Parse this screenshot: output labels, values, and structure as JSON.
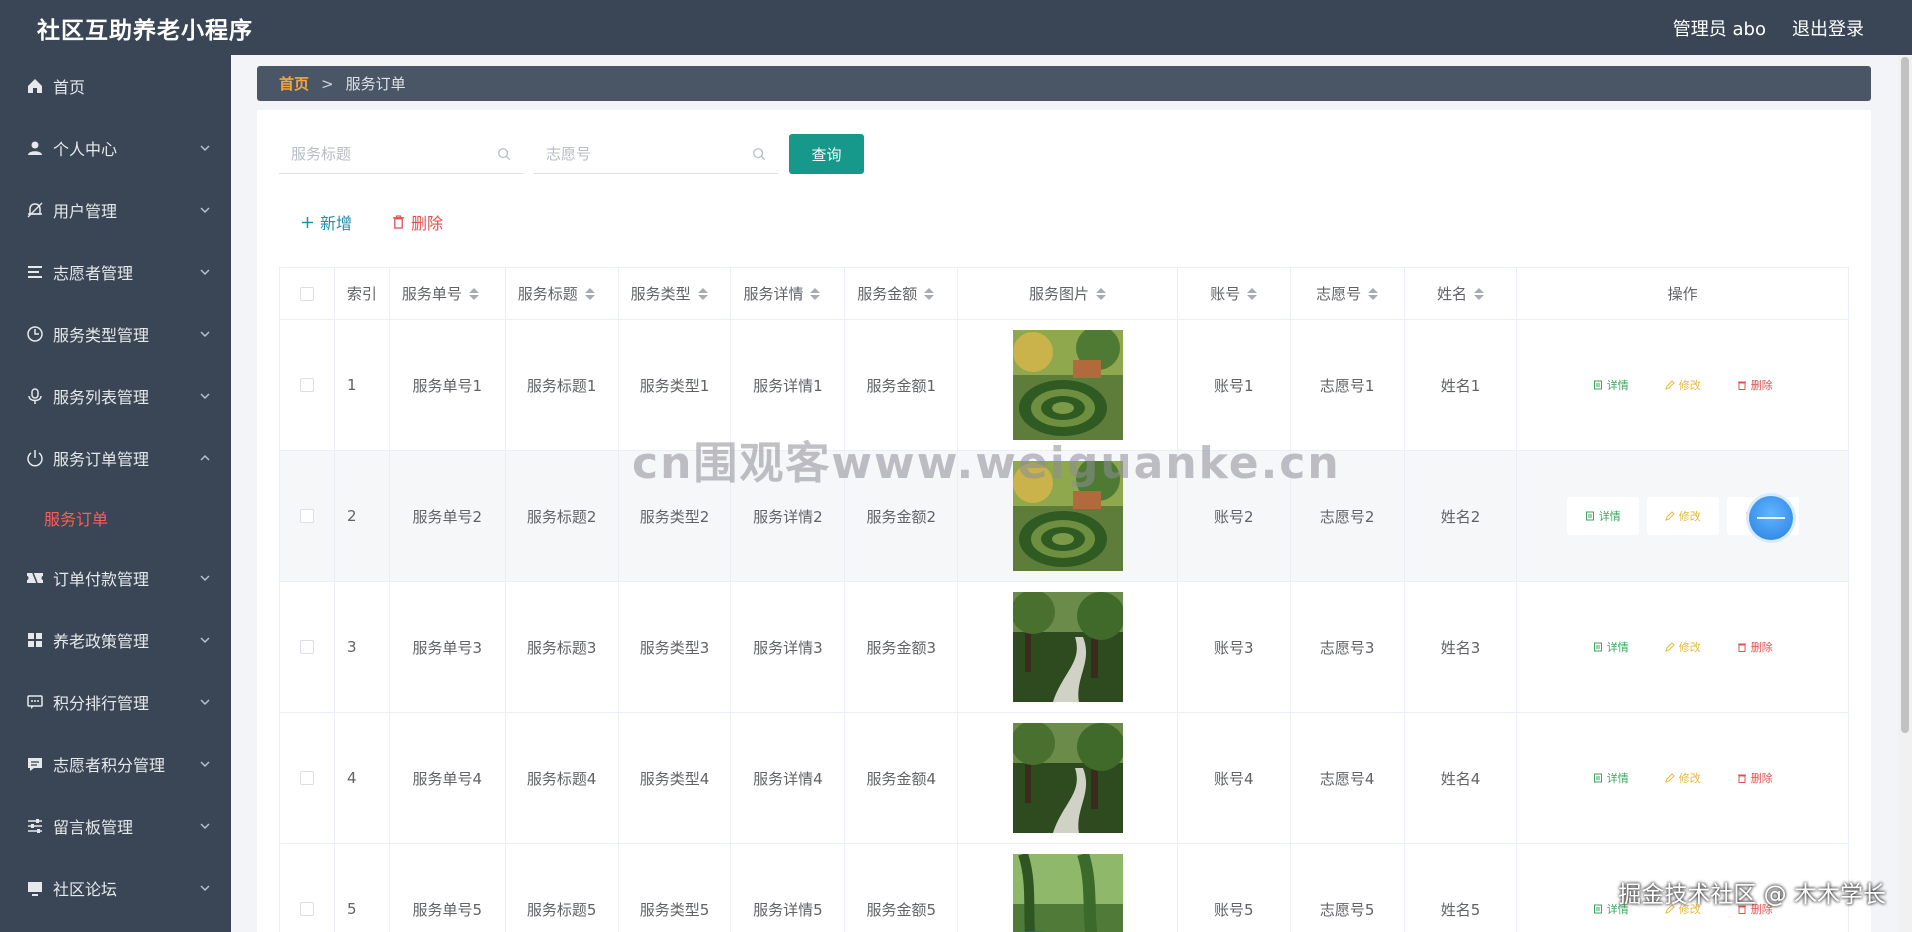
{
  "header": {
    "title": "社区互助养老小程序",
    "admin": "管理员 abo",
    "logout": "退出登录"
  },
  "sidebar": {
    "items": [
      {
        "label": "首页",
        "icon": "home-icon",
        "expandable": false
      },
      {
        "label": "个人中心",
        "icon": "user-icon",
        "expandable": true
      },
      {
        "label": "用户管理",
        "icon": "bell-icon",
        "expandable": true
      },
      {
        "label": "志愿者管理",
        "icon": "list-icon",
        "expandable": true
      },
      {
        "label": "服务类型管理",
        "icon": "clock-icon",
        "expandable": true
      },
      {
        "label": "服务列表管理",
        "icon": "mic-icon",
        "expandable": true
      },
      {
        "label": "服务订单管理",
        "icon": "power-icon",
        "expandable": true,
        "expanded": true
      },
      {
        "label": "订单付款管理",
        "icon": "ticket-icon",
        "expandable": true
      },
      {
        "label": "养老政策管理",
        "icon": "grid-icon",
        "expandable": true
      },
      {
        "label": "积分排行管理",
        "icon": "chat-icon",
        "expandable": true
      },
      {
        "label": "志愿者积分管理",
        "icon": "message-icon",
        "expandable": true
      },
      {
        "label": "留言板管理",
        "icon": "sliders-icon",
        "expandable": true
      },
      {
        "label": "社区论坛",
        "icon": "monitor-icon",
        "expandable": true
      }
    ],
    "subitem": "服务订单"
  },
  "breadcrumb": {
    "home": "首页",
    "sep": ">",
    "current": "服务订单"
  },
  "search": {
    "title_placeholder": "服务标题",
    "volunteer_placeholder": "志愿号",
    "query": "查询"
  },
  "actions": {
    "add": "新增",
    "delete": "删除"
  },
  "table": {
    "headers": [
      "索引",
      "服务单号",
      "服务标题",
      "服务类型",
      "服务详情",
      "服务金额",
      "服务图片",
      "账号",
      "志愿号",
      "姓名",
      "操作"
    ],
    "rows": [
      {
        "index": "1",
        "no": "服务单号1",
        "title": "服务标题1",
        "type": "服务类型1",
        "detail": "服务详情1",
        "amount": "服务金额1",
        "image": "garden-maze",
        "account": "账号1",
        "volunteer": "志愿号1",
        "name": "姓名1"
      },
      {
        "index": "2",
        "no": "服务单号2",
        "title": "服务标题2",
        "type": "服务类型2",
        "detail": "服务详情2",
        "amount": "服务金额2",
        "image": "garden-maze",
        "account": "账号2",
        "volunteer": "志愿号2",
        "name": "姓名2"
      },
      {
        "index": "3",
        "no": "服务单号3",
        "title": "服务标题3",
        "type": "服务类型3",
        "detail": "服务详情3",
        "amount": "服务金额3",
        "image": "forest-path",
        "account": "账号3",
        "volunteer": "志愿号3",
        "name": "姓名3"
      },
      {
        "index": "4",
        "no": "服务单号4",
        "title": "服务标题4",
        "type": "服务类型4",
        "detail": "服务详情4",
        "amount": "服务金额4",
        "image": "forest-path",
        "account": "账号4",
        "volunteer": "志愿号4",
        "name": "姓名4"
      },
      {
        "index": "5",
        "no": "服务单号5",
        "title": "服务标题5",
        "type": "服务类型5",
        "detail": "服务详情5",
        "amount": "服务金额5",
        "image": "willow-creek",
        "account": "账号5",
        "volunteer": "志愿号5",
        "name": "姓名5"
      }
    ],
    "ops": {
      "detail": "详情",
      "edit": "修改",
      "delete": "删除"
    }
  },
  "watermark": "cn围观客www.weiguanke.cn",
  "credit": "掘金技术社区 @ 木木学长",
  "colors": {
    "header_bg": "#3a4655",
    "accent": "#16998a",
    "breadcrumb_home": "#f0a742",
    "active_sub": "#ff5b5b",
    "danger": "#e05050",
    "success": "#3ca55c",
    "warning": "#e6b93a"
  }
}
